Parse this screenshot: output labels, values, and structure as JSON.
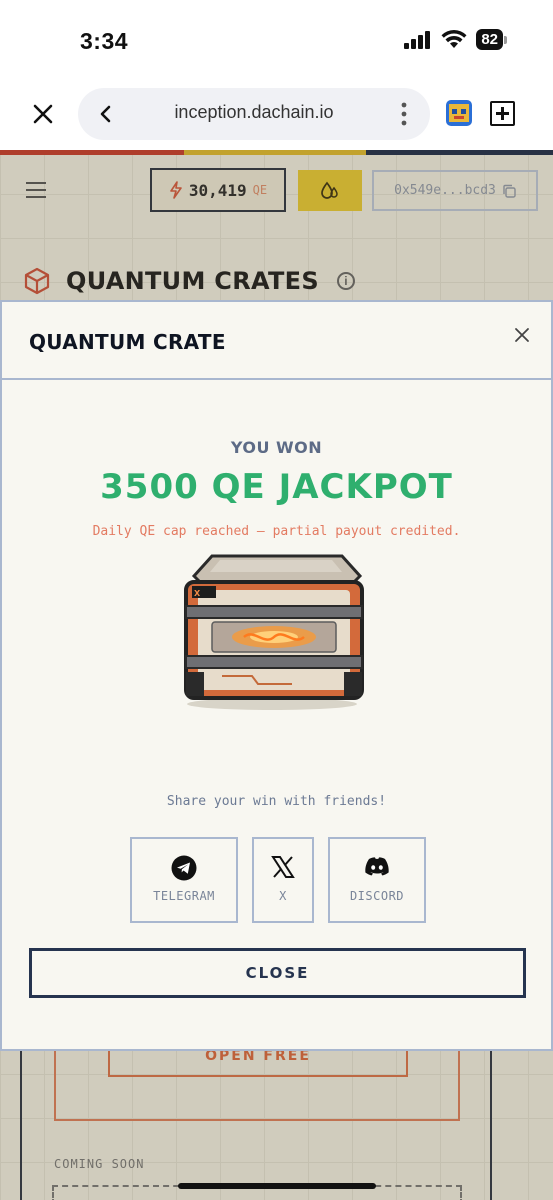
{
  "status_bar": {
    "time": "3:34",
    "battery": "82"
  },
  "browser": {
    "url": "inception.dachain.io"
  },
  "header": {
    "qe_balance": "30,419",
    "qe_unit": "QE",
    "wallet": "0x549e...bcd3"
  },
  "page": {
    "title": "QUANTUM CRATES",
    "open_free": "OPEN FREE",
    "coming_soon": "COMING SOON"
  },
  "modal": {
    "title": "QUANTUM CRATE",
    "you_won": "YOU WON",
    "prize": "3500 QE JACKPOT",
    "note": "Daily QE cap reached — partial payout credited.",
    "share_prompt": "Share your win with friends!",
    "share_buttons": [
      "TELEGRAM",
      "X",
      "DISCORD"
    ],
    "close_label": "CLOSE"
  },
  "colors": {
    "accent_green": "#2faf6e",
    "note_orange": "#e37b62",
    "border_blue": "#a9b7cf",
    "navy": "#26344f"
  }
}
